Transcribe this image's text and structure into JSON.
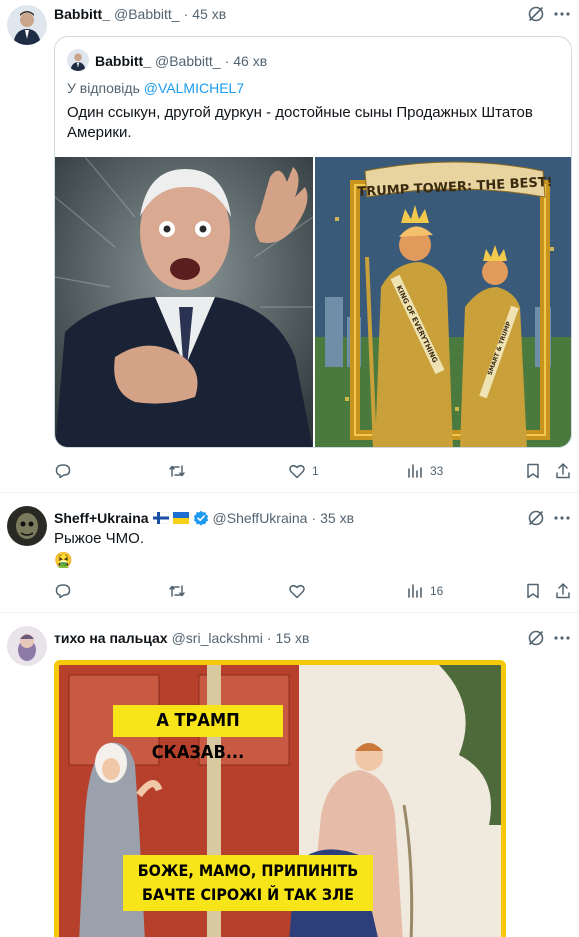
{
  "tweet1": {
    "name": "Babbitt_",
    "handle": "@Babbitt_",
    "time": "45 хв",
    "quote": {
      "name": "Babbitt_",
      "handle": "@Babbitt_",
      "time": "46 хв",
      "reply_prefix": "У відповідь ",
      "reply_to": "@VALMICHEL7",
      "text": "Один ссыкун, другой дуркун - достойные сыны Продажных Штатов Америки.",
      "image2_banner": "TRUMP TOWER: THE BEST!",
      "image2_sash": "KING OF EVERYTHING",
      "image2_sash2": "SMART & TRUMP"
    },
    "actions": {
      "reply": "",
      "retweet": "",
      "like": "1",
      "views": "33"
    }
  },
  "tweet2": {
    "name": "Sheff+Ukraina",
    "handle": "@SheffUkraina",
    "time": "35 хв",
    "text": "Рыжое ЧМО.",
    "emoji": "🤮",
    "actions": {
      "reply": "",
      "retweet": "",
      "like": "",
      "views": "16"
    }
  },
  "tweet3": {
    "name": "тихо на пальцах",
    "handle": "@sri_lackshmi",
    "time": "15 хв",
    "meme_top": "А ТРАМП СКАЗАВ...",
    "meme_bottom_1": "БОЖЕ, МАМО, ПРИПИНІТЬ",
    "meme_bottom_2": "БАЧТЕ СІРОЖІ Й ТАК ЗЛЕ"
  },
  "colors": {
    "text": "#0f1419",
    "muted": "#536471",
    "link": "#1d9bf0",
    "border": "#cfd9de",
    "verified": "#1d9bf0"
  }
}
